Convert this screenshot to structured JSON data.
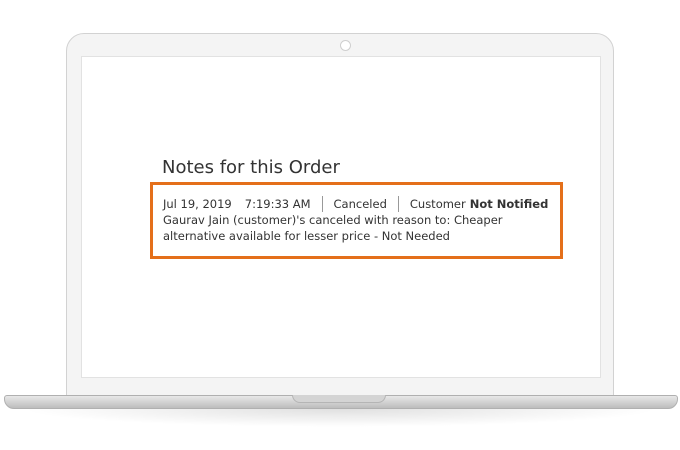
{
  "notes": {
    "title": "Notes for this Order",
    "entry": {
      "date": "Jul 19, 2019",
      "time": "7:19:33 AM",
      "status": "Canceled",
      "customer_label": "Customer",
      "notified_status": "Not Notified",
      "comment": "Gaurav Jain (customer)'s canceled with reason to: Cheaper alternative available for lesser price - Not Needed"
    }
  },
  "colors": {
    "highlight_border": "#e46f1a",
    "text": "#333333"
  }
}
